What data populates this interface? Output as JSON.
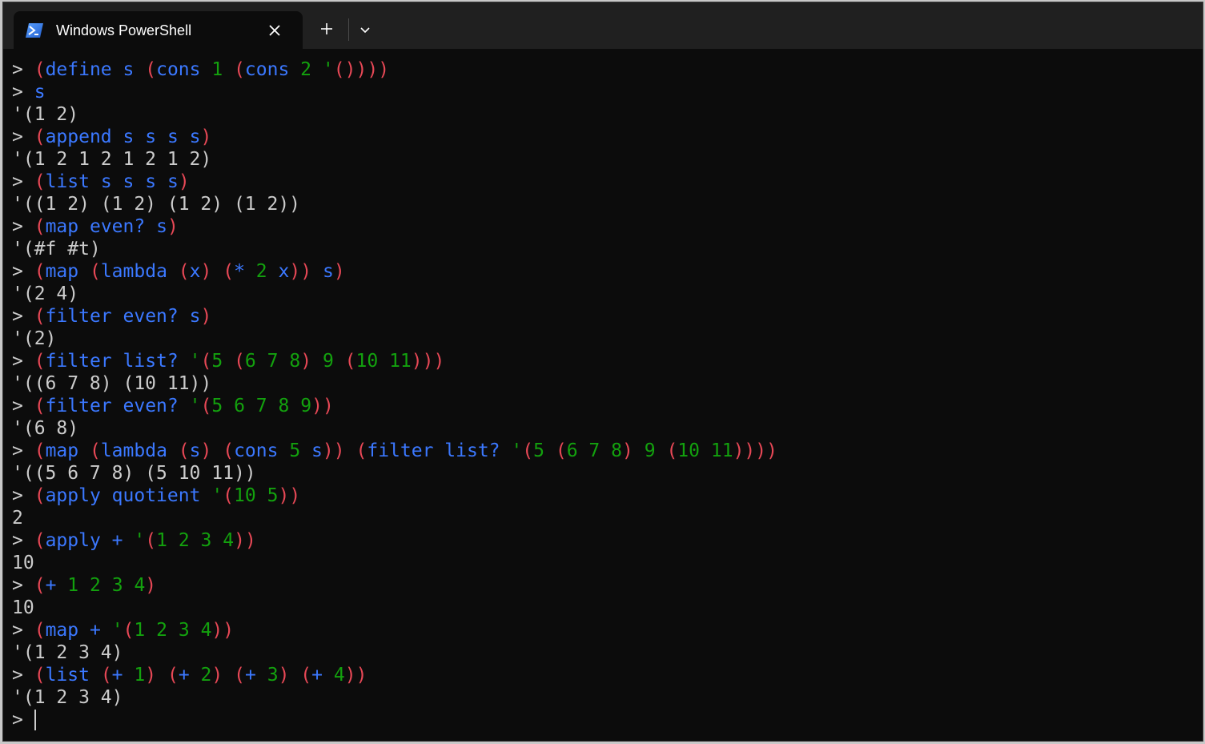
{
  "window": {
    "tab_title": "Windows PowerShell",
    "new_tab_symbol": "+",
    "colors": {
      "background": "#0c0c0c",
      "titlebar": "#202020",
      "paren": "#e74856",
      "identifier": "#3b78ff",
      "literal": "#13a10e",
      "text": "#cccccc"
    },
    "icons": [
      "powershell-icon",
      "close-icon",
      "plus-icon",
      "chevron-down-icon"
    ]
  },
  "terminal": {
    "prompt": ">",
    "lines": [
      {
        "type": "input",
        "text": "(define s (cons 1 (cons 2 '())))"
      },
      {
        "type": "input",
        "text": "s"
      },
      {
        "type": "output",
        "text": "'(1 2)"
      },
      {
        "type": "input",
        "text": "(append s s s s)"
      },
      {
        "type": "output",
        "text": "'(1 2 1 2 1 2 1 2)"
      },
      {
        "type": "input",
        "text": "(list s s s s)"
      },
      {
        "type": "output",
        "text": "'((1 2) (1 2) (1 2) (1 2))"
      },
      {
        "type": "input",
        "text": "(map even? s)"
      },
      {
        "type": "output",
        "text": "'(#f #t)"
      },
      {
        "type": "input",
        "text": "(map (lambda (x) (* 2 x)) s)"
      },
      {
        "type": "output",
        "text": "'(2 4)"
      },
      {
        "type": "input",
        "text": "(filter even? s)"
      },
      {
        "type": "output",
        "text": "'(2)"
      },
      {
        "type": "input",
        "text": "(filter list? '(5 (6 7 8) 9 (10 11)))"
      },
      {
        "type": "output",
        "text": "'((6 7 8) (10 11))"
      },
      {
        "type": "input",
        "text": "(filter even? '(5 6 7 8 9))"
      },
      {
        "type": "output",
        "text": "'(6 8)"
      },
      {
        "type": "input",
        "text": "(map (lambda (s) (cons 5 s)) (filter list? '(5 (6 7 8) 9 (10 11))))"
      },
      {
        "type": "output",
        "text": "'((5 6 7 8) (5 10 11))"
      },
      {
        "type": "input",
        "text": "(apply quotient '(10 5))"
      },
      {
        "type": "output",
        "text": "2"
      },
      {
        "type": "input",
        "text": "(apply + '(1 2 3 4))"
      },
      {
        "type": "output",
        "text": "10"
      },
      {
        "type": "input",
        "text": "(+ 1 2 3 4)"
      },
      {
        "type": "output",
        "text": "10"
      },
      {
        "type": "input",
        "text": "(map + '(1 2 3 4))"
      },
      {
        "type": "output",
        "text": "'(1 2 3 4)"
      },
      {
        "type": "input",
        "text": "(list (+ 1) (+ 2) (+ 3) (+ 4))"
      },
      {
        "type": "output",
        "text": "'(1 2 3 4)"
      },
      {
        "type": "input",
        "text": ""
      }
    ]
  }
}
